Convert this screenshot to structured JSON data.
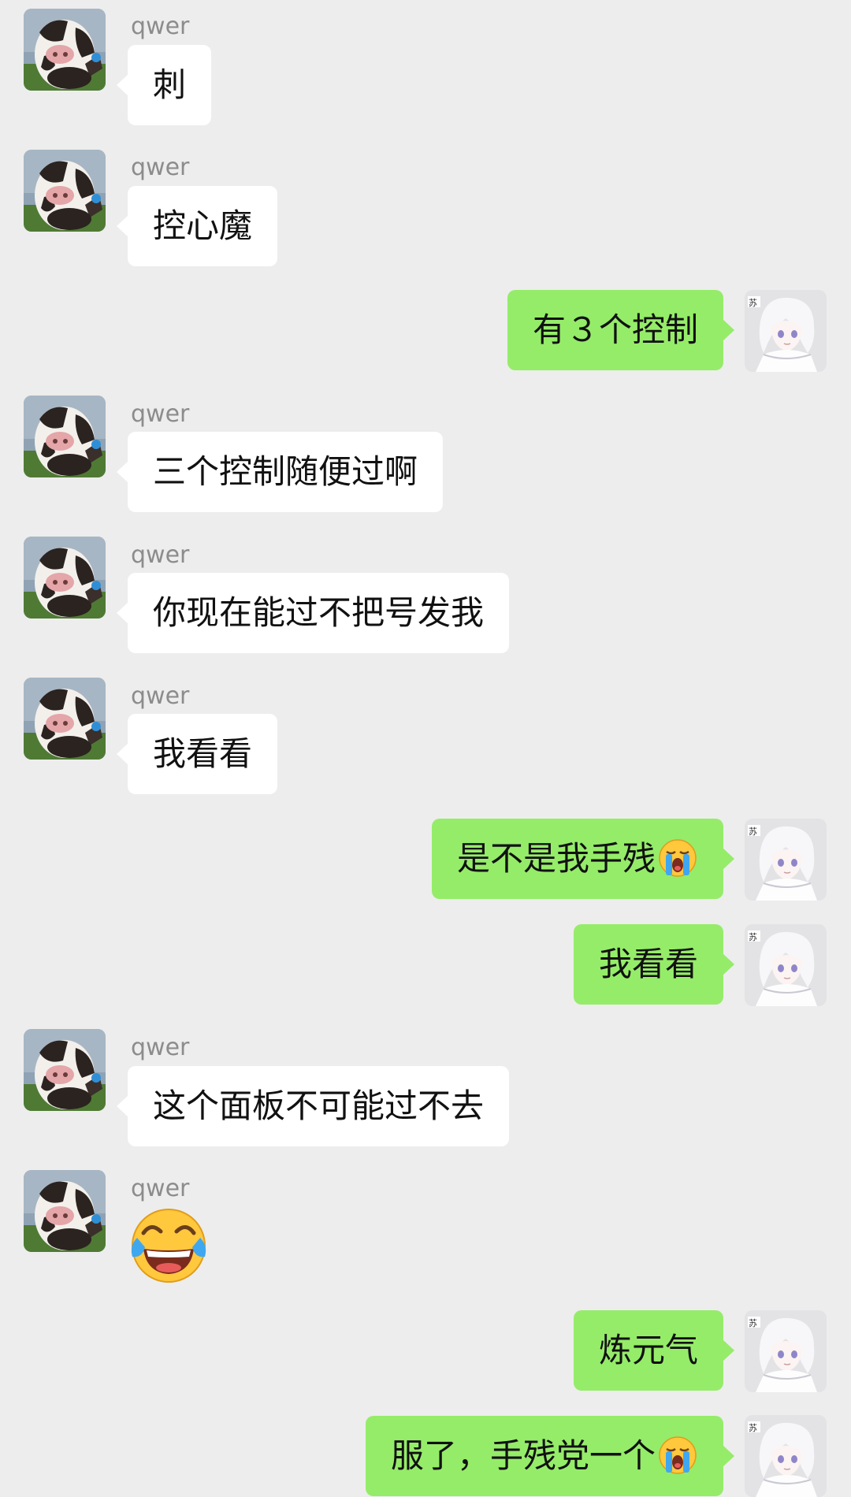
{
  "contact": {
    "name": "qwer"
  },
  "messages": [
    {
      "side": "in",
      "text": "刺"
    },
    {
      "side": "in",
      "text": "控心魔"
    },
    {
      "side": "out",
      "text": "有３个控制"
    },
    {
      "side": "in",
      "text": "三个控制随便过啊"
    },
    {
      "side": "in",
      "text": "你现在能过不把号发我"
    },
    {
      "side": "in",
      "text": "我看看"
    },
    {
      "side": "out",
      "text": "是不是我手残",
      "emoji": "loudly-crying-face"
    },
    {
      "side": "out",
      "text": "我看看"
    },
    {
      "side": "in",
      "text": "这个面板不可能过不去"
    },
    {
      "side": "in",
      "emoji": "face-with-tears-of-joy"
    },
    {
      "side": "out",
      "text": "炼元气"
    },
    {
      "side": "out",
      "text": "服了，手残党一个",
      "emoji": "loudly-crying-face"
    }
  ],
  "colors": {
    "background": "#ededed",
    "incoming_bubble": "#ffffff",
    "outgoing_bubble": "#95ec69",
    "sender_name": "#8c8c8c"
  },
  "icons": {
    "contact_avatar": "cow-photo-avatar",
    "self_avatar": "white-haired-anime-avatar"
  }
}
